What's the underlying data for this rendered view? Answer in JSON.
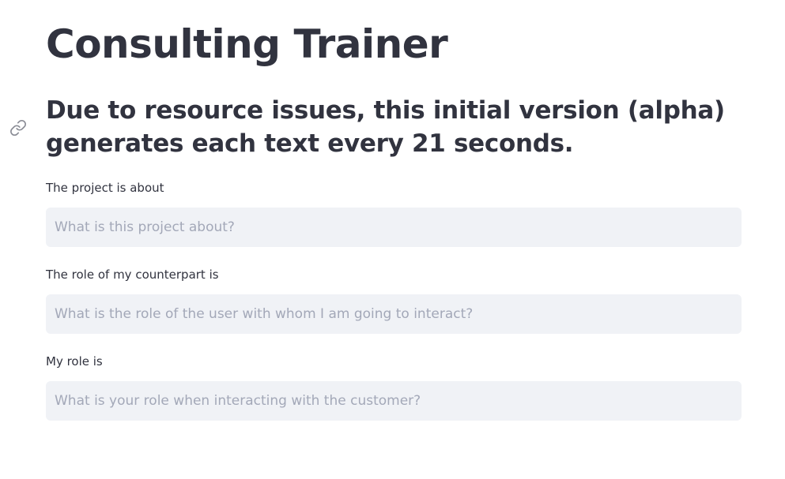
{
  "page": {
    "title": "Consulting Trainer",
    "subtitle": "Due to resource issues, this initial version (alpha) generates each text every 21 seconds."
  },
  "icons": {
    "anchor": "link-icon"
  },
  "fields": [
    {
      "label": "The project is about",
      "value": "",
      "placeholder": "What is this project about?"
    },
    {
      "label": "The role of my counterpart is",
      "value": "",
      "placeholder": "What is the role of the user with whom I am going to interact?"
    },
    {
      "label": "My role is",
      "value": "",
      "placeholder": "What is your role when interacting with the customer?"
    }
  ],
  "colors": {
    "text": "#31333f",
    "input_background": "#f0f2f6",
    "placeholder": "#a3a8b8"
  }
}
